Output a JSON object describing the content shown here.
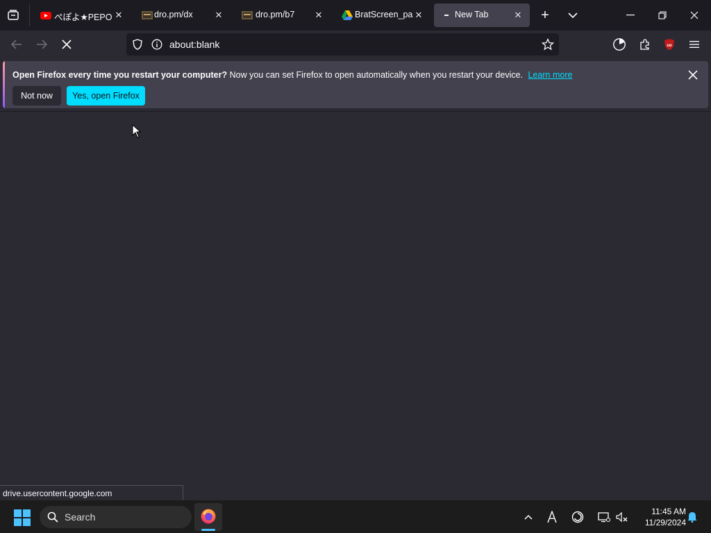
{
  "tabs": [
    {
      "label": "ぺぽよ★PEPOYO"
    },
    {
      "label": "dro.pm/dx"
    },
    {
      "label": "dro.pm/b7"
    },
    {
      "label": "BratScreen_pass"
    },
    {
      "label": "New Tab"
    }
  ],
  "navbar": {
    "url": "about:blank"
  },
  "infobar": {
    "title": "Open Firefox every time you restart your computer?",
    "message": "Now you can set Firefox to open automatically when you restart your device.",
    "learn_more": "Learn more",
    "not_now": "Not now",
    "yes_open": "Yes, open Firefox"
  },
  "status": {
    "link": "drive.usercontent.google.com"
  },
  "taskbar": {
    "search_placeholder": "Search",
    "time": "11:45 AM",
    "date": "11/29/2024"
  },
  "colors": {
    "accent": "#00ddff",
    "ublock": "#c11b1b",
    "notification": "#4cc2ff"
  }
}
